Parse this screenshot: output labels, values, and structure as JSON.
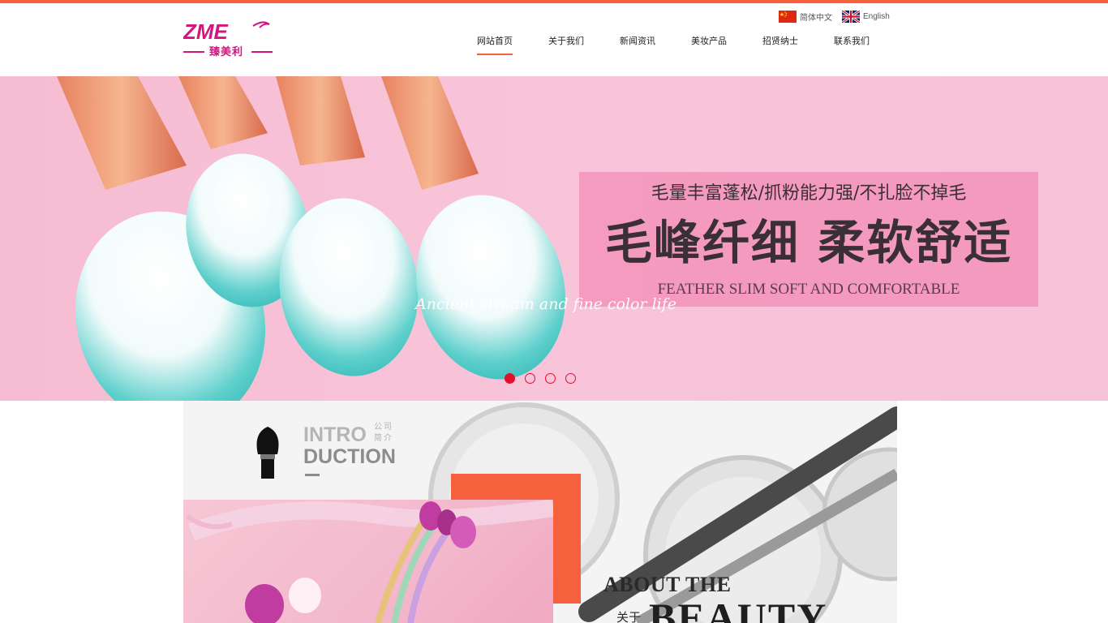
{
  "brand": {
    "logo_letters": "ZME",
    "logo_name": "臻美利",
    "accent": "#f4613c",
    "brand_pink": "#d4147f"
  },
  "language": {
    "chinese": "简体中文",
    "english": "English"
  },
  "nav": {
    "items": [
      {
        "label": "网站首页",
        "active": true
      },
      {
        "label": "关于我们"
      },
      {
        "label": "新闻资讯"
      },
      {
        "label": "美妆产品"
      },
      {
        "label": "招贤纳士"
      },
      {
        "label": "联系我们"
      }
    ]
  },
  "hero": {
    "subtitle": "毛量丰富蓬松/抓粉能力强/不扎脸不掉毛",
    "title": "毛峰纤细 柔软舒适",
    "english": "FEATHER SLIM  SOFT AND COMFORTABLE",
    "script": "Ancient stream and fine color life",
    "slides": 4,
    "active_slide": 1
  },
  "intro": {
    "title_line1": "INTRO",
    "title_line2": "DUCTION",
    "title_cn": "公司简介",
    "about_en": "ABOUT THE",
    "about_cn": "关于",
    "about_big": "BEAUTY"
  }
}
